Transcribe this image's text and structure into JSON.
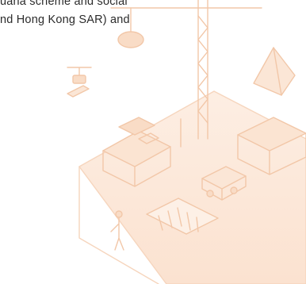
{
  "text": {
    "line_top": "uana scheme and social",
    "line_2": "nd Hong Kong SAR) and"
  },
  "illustration": {
    "icon": "isometric-construction-illustration",
    "tint": "#fbe3d2",
    "stroke": "#f4c9ab"
  }
}
